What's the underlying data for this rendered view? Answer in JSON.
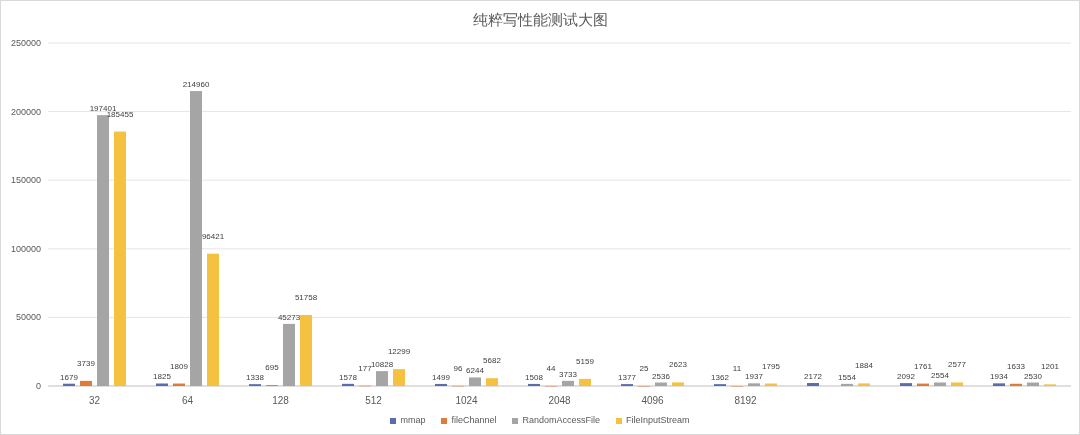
{
  "chart": {
    "chart_data": {
      "type": "bar",
      "title": "纯粹写性能测试大图",
      "categories": [
        "32",
        "64",
        "128",
        "512",
        "1024",
        "2048",
        "4096",
        "8192",
        null,
        null,
        null
      ],
      "series": [
        {
          "name": "mmap",
          "color": "#5b6bb0",
          "values": [
            1679,
            1825,
            1338,
            1578,
            1499,
            1508,
            1377,
            1362,
            2172,
            2092,
            1934
          ]
        },
        {
          "name": "fileChannel",
          "color": "#e07b39",
          "values": [
            3739,
            1809,
            695,
            177,
            96,
            44,
            25,
            11,
            null,
            1761,
            1633
          ]
        },
        {
          "name": "RandomAccessFile",
          "color": "#a5a5a5",
          "values": [
            197401,
            214960,
            45273,
            10828,
            6244,
            3733,
            2536,
            1937,
            1554,
            2554,
            2530
          ]
        },
        {
          "name": "FileInputStream",
          "color": "#f5c140",
          "values": [
            185455,
            96421,
            51758,
            12299,
            5682,
            5159,
            2623,
            1795,
            1884,
            2577,
            1201
          ]
        }
      ],
      "ylim": [
        0,
        250000
      ],
      "yticks": [
        0,
        50000,
        100000,
        150000,
        200000,
        250000
      ],
      "data_labels": true,
      "grid": true
    }
  }
}
